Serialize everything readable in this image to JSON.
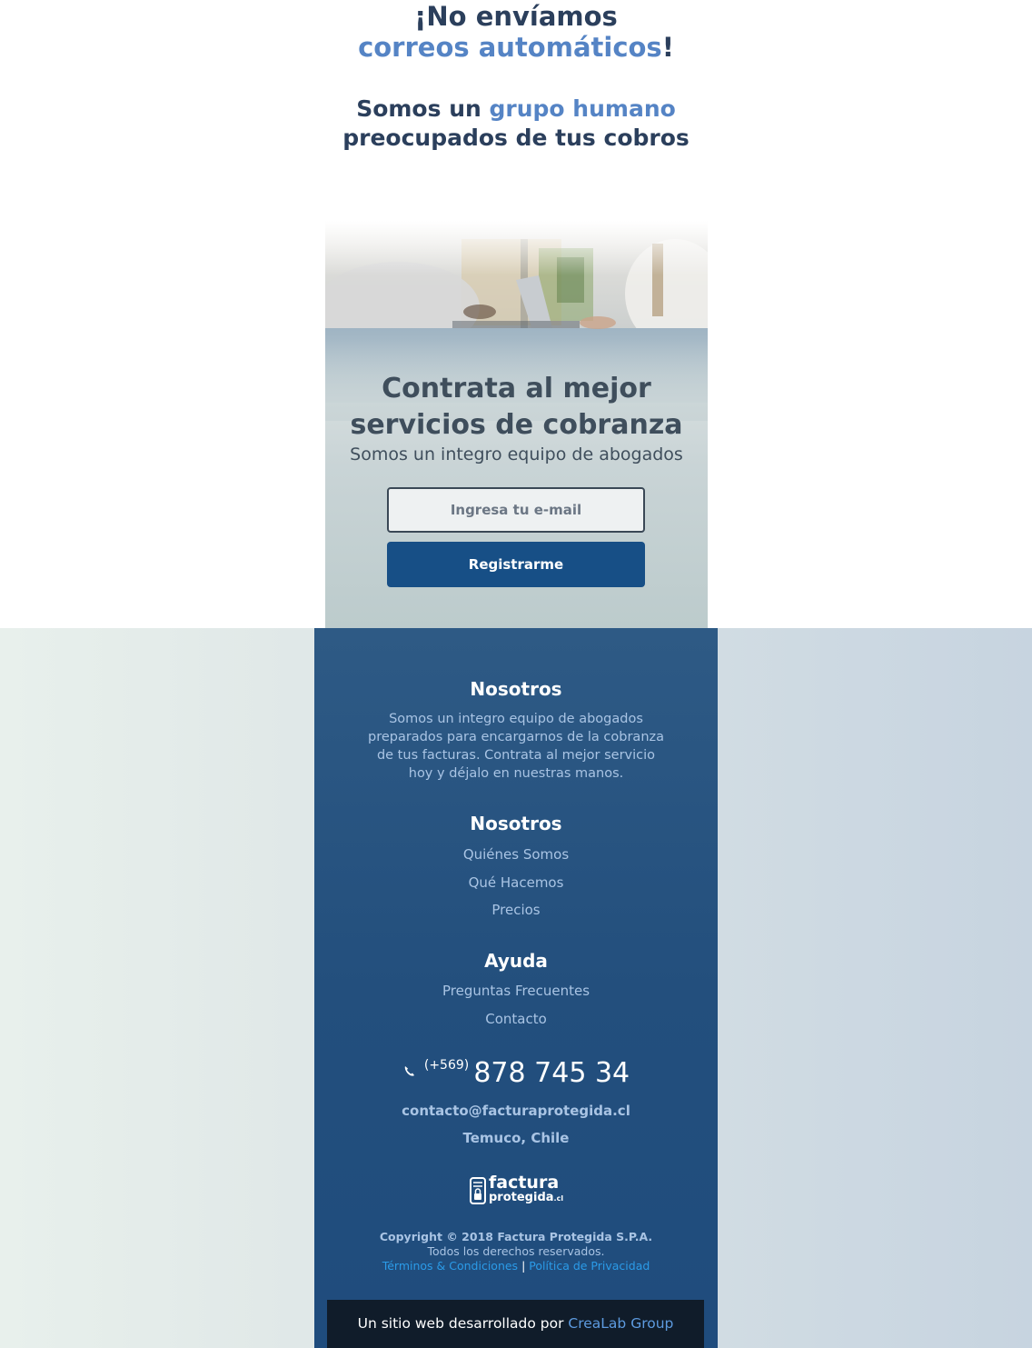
{
  "headline": {
    "line1": "¡No envíamos",
    "line2_accent": "correos automáticos",
    "line2_end": "!",
    "sub_line1_start": "Somos un ",
    "sub_line1_accent": "grupo humano",
    "sub_line2": "preocupados de tus cobros"
  },
  "hero": {
    "title_line1": "Contrata al mejor",
    "title_line2": "servicios de cobranza",
    "subtitle": "Somos un integro equipo de abogados",
    "email_placeholder": "Ingresa tu e-mail",
    "register_label": "Registrarme"
  },
  "footer": {
    "about_heading": "Nosotros",
    "about_lines": [
      "Somos un integro equipo de abogados",
      "preparados para encargarnos de la cobranza",
      "de tus facturas. Contrata al mejor servicio",
      "hoy y déjalo en nuestras manos."
    ],
    "nav_heading": "Nosotros",
    "nav_links": [
      "Quiénes Somos",
      "Qué Hacemos",
      "Precios"
    ],
    "help_heading": "Ayuda",
    "help_links": [
      "Preguntas Frecuentes",
      "Contacto"
    ],
    "phone_prefix": "(+569)",
    "phone_number": "878 745 34",
    "email": "contacto@facturaprotegida.cl",
    "location": "Temuco, Chile",
    "logo_line1": "factura",
    "logo_line2": "protegida",
    "logo_suffix": ".cl",
    "copyright": "Copyright © 2018 Factura Protegida S.P.A.",
    "rights": "Todos los derechos reservados.",
    "terms": "Términos & Condiciones",
    "separator": "|",
    "privacy": "Política de Privacidad",
    "credit_text": "Un sitio web desarrollado por ",
    "credit_link": "CreaLab Group"
  },
  "colors": {
    "heading": "#2b3f5c",
    "accent": "#5584c5",
    "button": "#174f86",
    "footer_panel": "#234f7d",
    "footer_text": "#a9c4e4",
    "link_blue": "#2b9be8",
    "credit_bar": "#101c2a"
  }
}
